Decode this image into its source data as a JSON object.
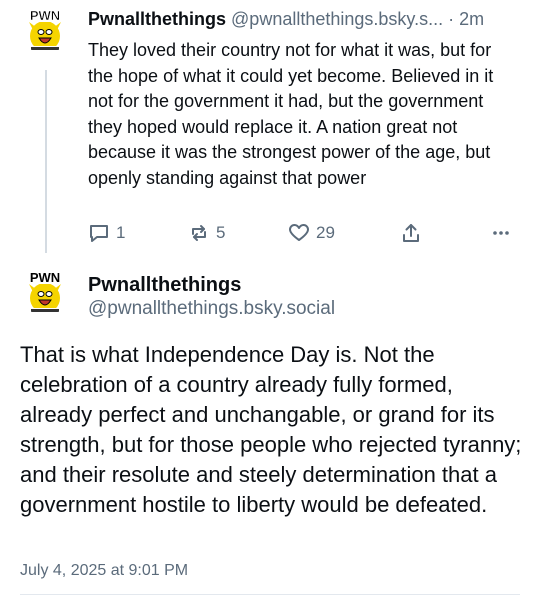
{
  "post1": {
    "display_name": "Pwnallthethings",
    "handle": "@pwnallthethings.bsky.s...",
    "separator": "·",
    "time": "2m",
    "text": "They loved their country not for what it was, but for the hope of what it could yet become. Believed in it not for the government it had, but the government they hoped would replace it. A nation great not because it was the strongest power of the age, but openly standing against that power",
    "replies": "1",
    "reposts": "5",
    "likes": "29",
    "avatar_label": "PWN"
  },
  "post2": {
    "display_name": "Pwnallthethings",
    "handle": "@pwnallthethings.bsky.social",
    "text": "That is what Independence Day is. Not the celebration of a country already fully formed, already perfect and unchangable, or grand for its strength, but for those people who rejected tyranny; and their resolute and steely determination that a government hostile to liberty would be defeated.",
    "timestamp": "July 4, 2025 at 9:01 PM",
    "avatar_label": "PWN"
  },
  "icons": {
    "reply": "speech-bubble-icon",
    "repost": "repost-arrows-icon",
    "like": "heart-icon",
    "share": "share-upload-icon",
    "more": "ellipsis-icon"
  },
  "colors": {
    "text": "#0b0f14",
    "muted": "#5b6b7b",
    "avatar_yellow": "#f5d400",
    "thread_line": "#d4dbe2"
  }
}
